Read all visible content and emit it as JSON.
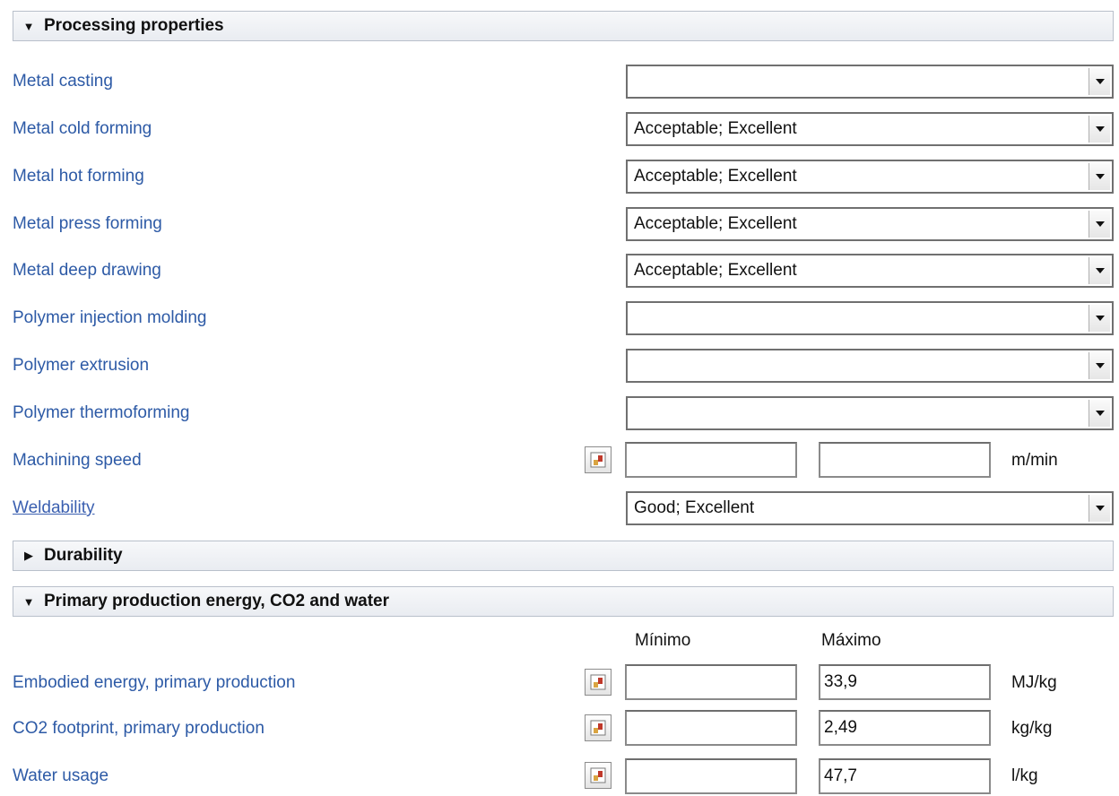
{
  "sections": {
    "processing": {
      "title": "Processing properties",
      "expanded": true
    },
    "durability": {
      "title": "Durability",
      "expanded": false
    },
    "energy": {
      "title": "Primary production energy, CO2 and water",
      "expanded": true
    }
  },
  "processing_rows": [
    {
      "label": "Metal casting",
      "value": ""
    },
    {
      "label": "Metal cold forming",
      "value": "Acceptable; Excellent"
    },
    {
      "label": "Metal hot forming",
      "value": "Acceptable; Excellent"
    },
    {
      "label": "Metal press forming",
      "value": "Acceptable; Excellent"
    },
    {
      "label": "Metal deep drawing",
      "value": "Acceptable; Excellent"
    },
    {
      "label": "Polymer injection molding",
      "value": ""
    },
    {
      "label": "Polymer extrusion",
      "value": ""
    },
    {
      "label": "Polymer thermoforming",
      "value": ""
    }
  ],
  "machining": {
    "label": "Machining speed",
    "min": "",
    "max": "",
    "unit": "m/min"
  },
  "weldability": {
    "label": "Weldability",
    "value": "Good; Excellent"
  },
  "columns": {
    "min": "Mínimo",
    "max": "Máximo"
  },
  "energy_rows": [
    {
      "label": "Embodied energy, primary production",
      "min": "",
      "max": "33,9",
      "unit": "MJ/kg"
    },
    {
      "label": "CO2 footprint, primary production",
      "min": "",
      "max": "2,49",
      "unit": "kg/kg"
    },
    {
      "label": "Water usage",
      "min": "",
      "max": "47,7",
      "unit": "l/kg"
    }
  ],
  "icons": {
    "expanded": "triangle-down-icon",
    "collapsed": "triangle-right-icon",
    "dropdown": "chevron-down-icon",
    "range": "range-chart-icon"
  }
}
